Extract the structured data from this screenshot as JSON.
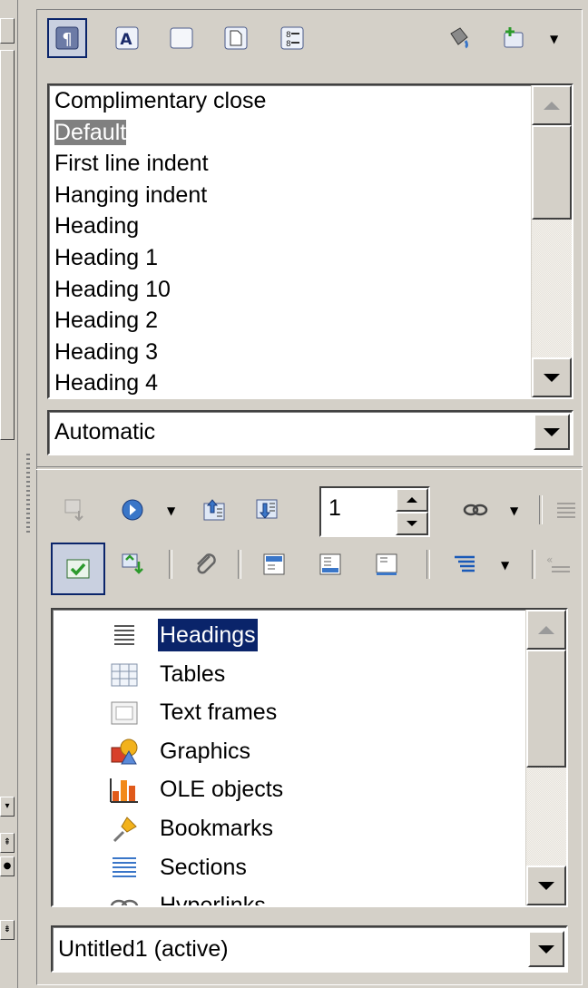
{
  "styles": {
    "items": [
      "Complimentary close",
      "Default",
      "First line indent",
      "Hanging indent",
      "Heading",
      "Heading 1",
      "Heading 10",
      "Heading 2",
      "Heading 3",
      "Heading 4"
    ],
    "selected_index": 1,
    "filter_value": "Automatic"
  },
  "navigator": {
    "page_value": "1",
    "items": [
      {
        "label": "Headings",
        "icon": "headings-icon",
        "selected": true
      },
      {
        "label": "Tables",
        "icon": "tables-icon"
      },
      {
        "label": "Text frames",
        "icon": "text-frames-icon"
      },
      {
        "label": "Graphics",
        "icon": "graphics-icon"
      },
      {
        "label": "OLE objects",
        "icon": "ole-objects-icon"
      },
      {
        "label": "Bookmarks",
        "icon": "bookmarks-icon"
      },
      {
        "label": "Sections",
        "icon": "sections-icon"
      },
      {
        "label": "Hyperlinks",
        "icon": "hyperlinks-icon"
      }
    ],
    "document_value": "Untitled1 (active)"
  },
  "colors": {
    "selection": "#0a246a",
    "face": "#d4d0c8"
  }
}
